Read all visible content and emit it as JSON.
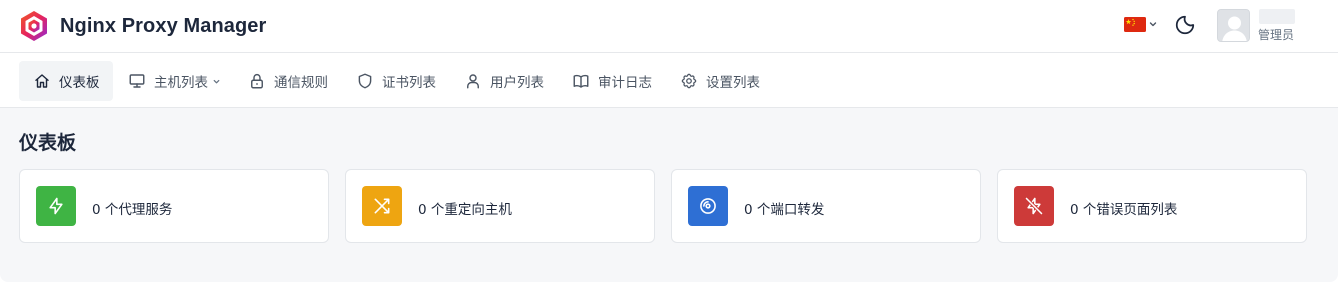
{
  "app": {
    "title": "Nginx Proxy Manager"
  },
  "header": {
    "language_flag": "cn-flag-icon",
    "user_role": "管理员"
  },
  "nav": {
    "items": [
      {
        "label": "仪表板",
        "icon": "home-icon",
        "active": true
      },
      {
        "label": "主机列表",
        "icon": "monitor-icon",
        "has_dropdown": true
      },
      {
        "label": "通信规则",
        "icon": "lock-icon"
      },
      {
        "label": "证书列表",
        "icon": "shield-icon"
      },
      {
        "label": "用户列表",
        "icon": "user-icon"
      },
      {
        "label": "审计日志",
        "icon": "book-icon"
      },
      {
        "label": "设置列表",
        "icon": "gear-icon"
      }
    ]
  },
  "main": {
    "title": "仪表板",
    "stats": [
      {
        "count": "0",
        "label": "0 个代理服务",
        "icon": "bolt-icon",
        "color": "#3fb444"
      },
      {
        "count": "0",
        "label": "0 个重定向主机",
        "icon": "shuffle-icon",
        "color": "#eea511"
      },
      {
        "count": "0",
        "label": "0 个端口转发",
        "icon": "disc-icon",
        "color": "#2e6fd4"
      },
      {
        "count": "0",
        "label": "0 个错误页面列表",
        "icon": "bolt-off-icon",
        "color": "#cd3a39"
      }
    ]
  },
  "colors": {
    "nav_active_bg": "#f2f4f6",
    "page_bg": "#f6f7f9",
    "text": "#1d273b"
  }
}
